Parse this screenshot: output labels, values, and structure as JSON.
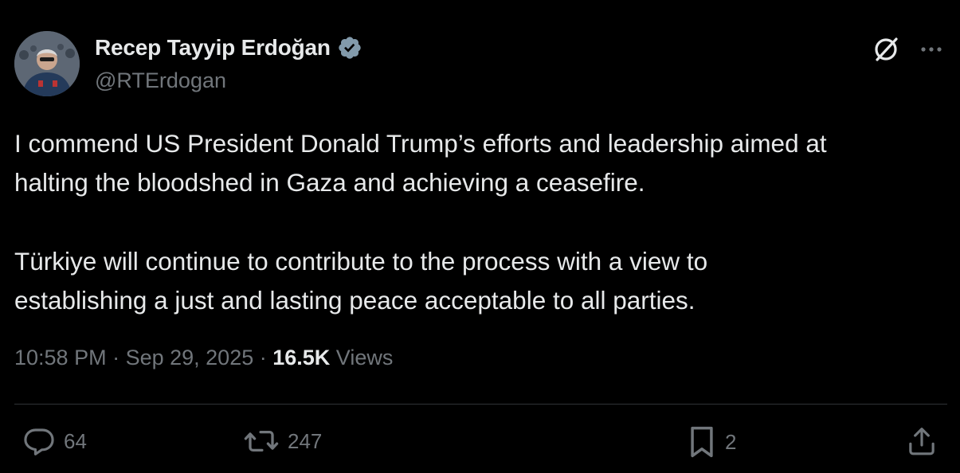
{
  "author": {
    "display_name": "Recep Tayyip Erdoğan",
    "handle": "@RTErdogan",
    "verified_color": "#829aab"
  },
  "tweet": {
    "paragraph1_line1": "I commend US President Donald Trump’s efforts and leadership aimed at",
    "paragraph1_line2": "halting the bloodshed in Gaza and achieving a ceasefire.",
    "paragraph2_line1": "Türkiye will continue to contribute to the process with a view to",
    "paragraph2_line2": "establishing a just and lasting peace acceptable to all parties."
  },
  "meta": {
    "time": "10:58 PM",
    "separator": " · ",
    "date": "Sep 29, 2025",
    "views_count": "16.5K",
    "views_label": " Views"
  },
  "actions": {
    "replies": "64",
    "reposts": "247",
    "bookmarks": "2"
  },
  "icons": {
    "reply": "speech-bubble-icon",
    "repost": "repost-arrows-icon",
    "bookmark": "bookmark-icon",
    "share": "share-icon",
    "grok": "grok-icon",
    "more": "more-dots-icon",
    "verified": "verified-badge-icon"
  },
  "colors": {
    "background": "#000000",
    "text": "#e7e9ea",
    "muted": "#71767b",
    "divider": "#2f3336"
  }
}
